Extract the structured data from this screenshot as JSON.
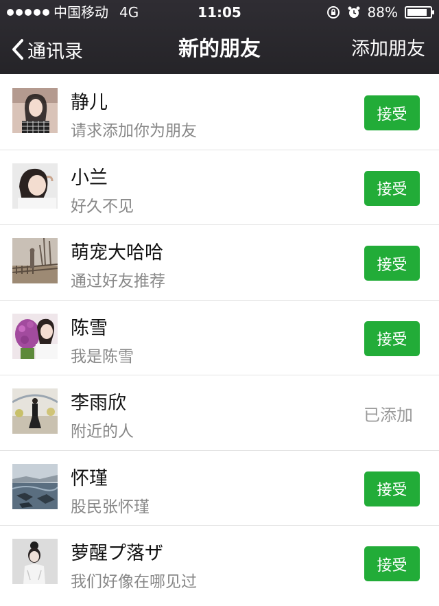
{
  "status": {
    "carrier": "中国移动",
    "network": "4G",
    "time": "11:05",
    "battery": "88%",
    "battery_level": 0.88
  },
  "nav": {
    "back_label": "通讯录",
    "title": "新的朋友",
    "action_label": "添加朋友"
  },
  "colors": {
    "accent": "#22ac38",
    "bar": "#2a292e"
  },
  "friends": [
    {
      "name": "静儿",
      "message": "请求添加你为朋友",
      "action": "接受",
      "added": false
    },
    {
      "name": "小兰",
      "message": "好久不见",
      "action": "接受",
      "added": false
    },
    {
      "name": "萌宠大哈哈",
      "message": "通过好友推荐",
      "action": "接受",
      "added": false
    },
    {
      "name": "陈雪",
      "message": "我是陈雪",
      "action": "接受",
      "added": false
    },
    {
      "name": "李雨欣",
      "message": "附近的人",
      "action": "已添加",
      "added": true
    },
    {
      "name": "怀瑾",
      "message": "股民张怀瑾",
      "action": "接受",
      "added": false
    },
    {
      "name": "萝醒プ落ザ",
      "message": "我们好像在哪见过",
      "action": "接受",
      "added": false
    }
  ]
}
